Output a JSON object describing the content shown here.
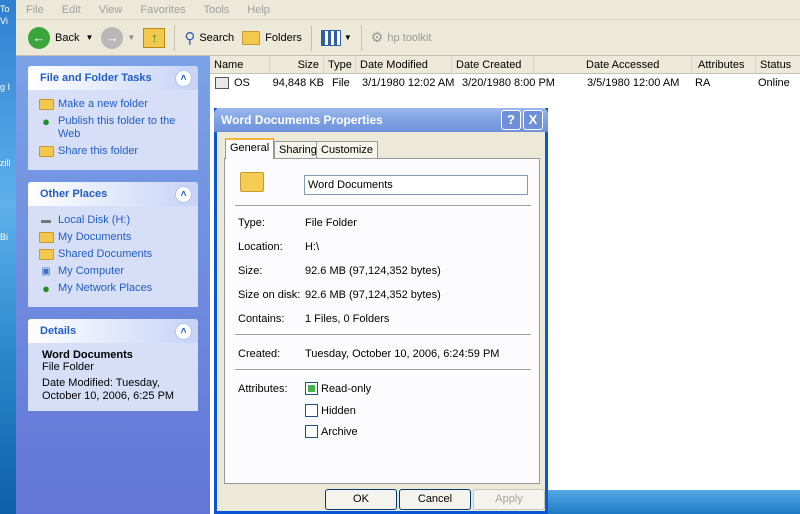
{
  "desktop": {
    "labels": [
      "To",
      "Vi",
      "g I",
      "zill",
      "Bi"
    ]
  },
  "menu": [
    "File",
    "Edit",
    "View",
    "Favorites",
    "Tools",
    "Help"
  ],
  "toolbar": {
    "back": "Back",
    "search": "Search",
    "folders": "Folders",
    "hp": "hp toolkit"
  },
  "sidebar": {
    "tasks_title": "File and Folder Tasks",
    "tasks": [
      "Make a new folder",
      "Publish this folder to the Web",
      "Share this folder"
    ],
    "places_title": "Other Places",
    "places": [
      "Local Disk (H:)",
      "My Documents",
      "Shared Documents",
      "My Computer",
      "My Network Places"
    ],
    "details_title": "Details",
    "details_name": "Word Documents",
    "details_type": "File Folder",
    "details_mod1": "Date Modified: Tuesday,",
    "details_mod2": "October 10, 2006, 6:25 PM"
  },
  "list": {
    "cols": [
      "Name",
      "Size",
      "Type",
      "Date Modified",
      "Date Created",
      "Date Accessed",
      "Attributes",
      "Status"
    ],
    "row": [
      "OS",
      "94,848 KB",
      "File",
      "3/1/1980 12:02 AM",
      "3/20/1980 8:00 PM",
      "3/5/1980 12:00 AM",
      "RA",
      "Online"
    ]
  },
  "dialog": {
    "title": "Word Documents Properties",
    "help": "?",
    "close": "X",
    "tabs": [
      "General",
      "Sharing",
      "Customize"
    ],
    "name": "Word Documents",
    "type_label": "Type:",
    "type_value": "File Folder",
    "location_label": "Location:",
    "location_value": "H:\\",
    "size_label": "Size:",
    "size_value": "92.6 MB (97,124,352 bytes)",
    "disk_label": "Size on disk:",
    "disk_value": "92.6 MB (97,124,352 bytes)",
    "contains_label": "Contains:",
    "contains_value": "1 Files, 0 Folders",
    "created_label": "Created:",
    "created_value": "Tuesday, October 10, 2006, 6:24:59 PM",
    "attr_label": "Attributes:",
    "readonly": "Read-only",
    "hidden": "Hidden",
    "archive": "Archive",
    "ok": "OK",
    "cancel": "Cancel",
    "apply": "Apply"
  },
  "colors": {
    "title_bar": "#0a57d6",
    "link": "#215dc6",
    "sidebar": "#6375d6"
  }
}
